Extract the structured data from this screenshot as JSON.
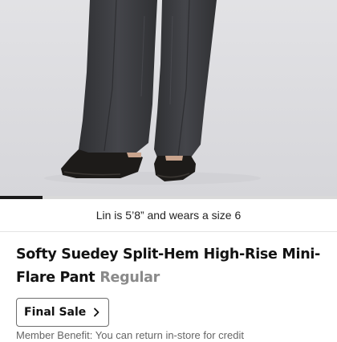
{
  "product_image": {
    "alt": "Model wearing dark grey mini-flare pants with black flats",
    "gallery_progress": 0.125
  },
  "model_info": {
    "text": "Lin is 5’8” and wears a size 6"
  },
  "product": {
    "title": "Softy Suedey Split-Hem High-Rise Mini-Flare Pant",
    "fit_variant": "Regular"
  },
  "final_sale": {
    "label": "Final Sale",
    "icon": "chevron-right-icon"
  },
  "member_benefit": {
    "text": "Member Benefit: You can return in-store for credit"
  },
  "colors": {
    "pants": "#3a3b3e",
    "shoes": "#1c1a18",
    "background": "#e3e3e6"
  }
}
